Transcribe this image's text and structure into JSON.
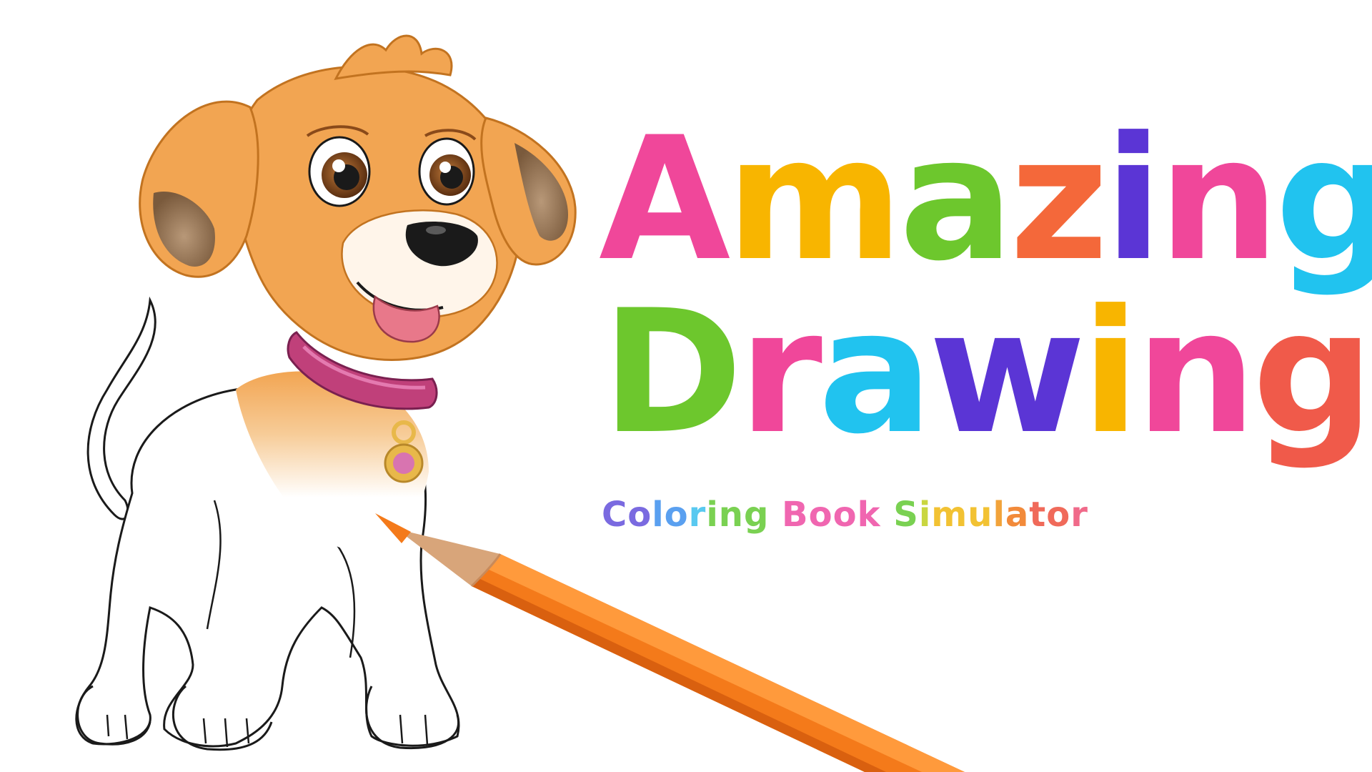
{
  "title": {
    "line1": {
      "text": "Amazing",
      "letters": [
        {
          "ch": "A",
          "color": "#f0479a"
        },
        {
          "ch": "m",
          "color": "#f8b500"
        },
        {
          "ch": "a",
          "color": "#6dc72d"
        },
        {
          "ch": "z",
          "color": "#f4683a"
        },
        {
          "ch": "i",
          "color": "#5b35d5"
        },
        {
          "ch": "n",
          "color": "#f0479a"
        },
        {
          "ch": "g",
          "color": "#21c3ef"
        }
      ]
    },
    "line2": {
      "text": "Drawing",
      "letters": [
        {
          "ch": "D",
          "color": "#6dc72d"
        },
        {
          "ch": "r",
          "color": "#f0479a"
        },
        {
          "ch": "a",
          "color": "#21c3ef"
        },
        {
          "ch": "w",
          "color": "#5b35d5"
        },
        {
          "ch": "i",
          "color": "#f8b500"
        },
        {
          "ch": "n",
          "color": "#f0479a"
        },
        {
          "ch": "g",
          "color": "#f05a4a"
        }
      ]
    }
  },
  "subtitle": {
    "text": "Coloring Book Simulator",
    "letters": [
      {
        "ch": "C",
        "color": "#7a6ae0"
      },
      {
        "ch": "o",
        "color": "#7a6ae0"
      },
      {
        "ch": "l",
        "color": "#5aa0f0"
      },
      {
        "ch": "o",
        "color": "#5aa0f0"
      },
      {
        "ch": "r",
        "color": "#59c9f0"
      },
      {
        "ch": "i",
        "color": "#7ad152"
      },
      {
        "ch": "n",
        "color": "#7ad152"
      },
      {
        "ch": "g",
        "color": "#7ad152"
      },
      {
        "ch": " ",
        "color": "#ffffff"
      },
      {
        "ch": "B",
        "color": "#f066b0"
      },
      {
        "ch": "o",
        "color": "#f066b0"
      },
      {
        "ch": "o",
        "color": "#f066b0"
      },
      {
        "ch": "k",
        "color": "#f066b0"
      },
      {
        "ch": " ",
        "color": "#ffffff"
      },
      {
        "ch": "S",
        "color": "#7ad152"
      },
      {
        "ch": "i",
        "color": "#c9d640"
      },
      {
        "ch": "m",
        "color": "#f2c233"
      },
      {
        "ch": "u",
        "color": "#f2c233"
      },
      {
        "ch": "l",
        "color": "#f2a33a"
      },
      {
        "ch": "a",
        "color": "#f28a3a"
      },
      {
        "ch": "t",
        "color": "#f06a5a"
      },
      {
        "ch": "o",
        "color": "#f06a5a"
      },
      {
        "ch": "r",
        "color": "#f06a8a"
      }
    ]
  },
  "colors": {
    "background": "#ffffff",
    "dog_fur": "#f2a552",
    "dog_fur_dark": "#e0842e",
    "dog_ear_inner": "#8a6a4a",
    "collar": "#c0407a",
    "tag": "#e8b84a",
    "pencil_body": "#f47a1a",
    "pencil_stripe": "#d9600f",
    "pencil_wood": "#d8a57a",
    "outline": "#1a1a1a"
  },
  "icons": {
    "dog": "cartoon-puppy-illustration",
    "pencil": "orange-colored-pencil"
  }
}
